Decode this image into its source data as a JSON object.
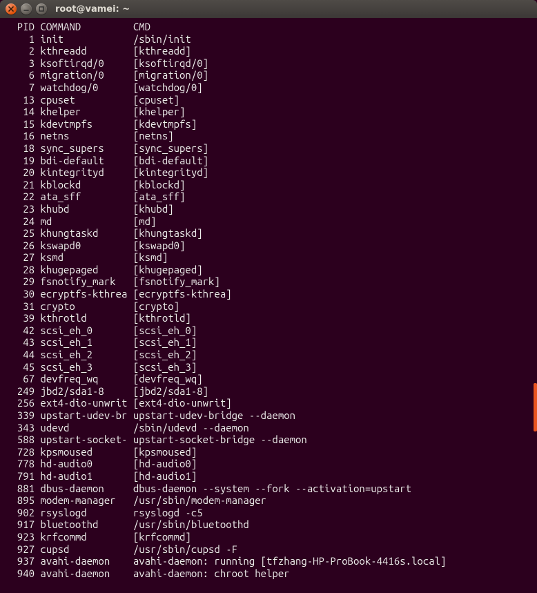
{
  "window": {
    "title": "root@vamei: ~"
  },
  "header": {
    "col_pid": "  PID",
    "col_command": "COMMAND",
    "col_cmd": "CMD"
  },
  "rows": [
    {
      "pid": "1",
      "command": "init",
      "cmd": "/sbin/init"
    },
    {
      "pid": "2",
      "command": "kthreadd",
      "cmd": "[kthreadd]"
    },
    {
      "pid": "3",
      "command": "ksoftirqd/0",
      "cmd": "[ksoftirqd/0]"
    },
    {
      "pid": "6",
      "command": "migration/0",
      "cmd": "[migration/0]"
    },
    {
      "pid": "7",
      "command": "watchdog/0",
      "cmd": "[watchdog/0]"
    },
    {
      "pid": "13",
      "command": "cpuset",
      "cmd": "[cpuset]"
    },
    {
      "pid": "14",
      "command": "khelper",
      "cmd": "[khelper]"
    },
    {
      "pid": "15",
      "command": "kdevtmpfs",
      "cmd": "[kdevtmpfs]"
    },
    {
      "pid": "16",
      "command": "netns",
      "cmd": "[netns]"
    },
    {
      "pid": "18",
      "command": "sync_supers",
      "cmd": "[sync_supers]"
    },
    {
      "pid": "19",
      "command": "bdi-default",
      "cmd": "[bdi-default]"
    },
    {
      "pid": "20",
      "command": "kintegrityd",
      "cmd": "[kintegrityd]"
    },
    {
      "pid": "21",
      "command": "kblockd",
      "cmd": "[kblockd]"
    },
    {
      "pid": "22",
      "command": "ata_sff",
      "cmd": "[ata_sff]"
    },
    {
      "pid": "23",
      "command": "khubd",
      "cmd": "[khubd]"
    },
    {
      "pid": "24",
      "command": "md",
      "cmd": "[md]"
    },
    {
      "pid": "25",
      "command": "khungtaskd",
      "cmd": "[khungtaskd]"
    },
    {
      "pid": "26",
      "command": "kswapd0",
      "cmd": "[kswapd0]"
    },
    {
      "pid": "27",
      "command": "ksmd",
      "cmd": "[ksmd]"
    },
    {
      "pid": "28",
      "command": "khugepaged",
      "cmd": "[khugepaged]"
    },
    {
      "pid": "29",
      "command": "fsnotify_mark",
      "cmd": "[fsnotify_mark]"
    },
    {
      "pid": "30",
      "command": "ecryptfs-kthrea",
      "cmd": "[ecryptfs-kthrea]"
    },
    {
      "pid": "31",
      "command": "crypto",
      "cmd": "[crypto]"
    },
    {
      "pid": "39",
      "command": "kthrotld",
      "cmd": "[kthrotld]"
    },
    {
      "pid": "42",
      "command": "scsi_eh_0",
      "cmd": "[scsi_eh_0]"
    },
    {
      "pid": "43",
      "command": "scsi_eh_1",
      "cmd": "[scsi_eh_1]"
    },
    {
      "pid": "44",
      "command": "scsi_eh_2",
      "cmd": "[scsi_eh_2]"
    },
    {
      "pid": "45",
      "command": "scsi_eh_3",
      "cmd": "[scsi_eh_3]"
    },
    {
      "pid": "67",
      "command": "devfreq_wq",
      "cmd": "[devfreq_wq]"
    },
    {
      "pid": "249",
      "command": "jbd2/sda1-8",
      "cmd": "[jbd2/sda1-8]"
    },
    {
      "pid": "256",
      "command": "ext4-dio-unwrit",
      "cmd": "[ext4-dio-unwrit]"
    },
    {
      "pid": "339",
      "command": "upstart-udev-br",
      "cmd": "upstart-udev-bridge --daemon"
    },
    {
      "pid": "343",
      "command": "udevd",
      "cmd": "/sbin/udevd --daemon"
    },
    {
      "pid": "588",
      "command": "upstart-socket-",
      "cmd": "upstart-socket-bridge --daemon"
    },
    {
      "pid": "728",
      "command": "kpsmoused",
      "cmd": "[kpsmoused]"
    },
    {
      "pid": "778",
      "command": "hd-audio0",
      "cmd": "[hd-audio0]"
    },
    {
      "pid": "791",
      "command": "hd-audio1",
      "cmd": "[hd-audio1]"
    },
    {
      "pid": "881",
      "command": "dbus-daemon",
      "cmd": "dbus-daemon --system --fork --activation=upstart"
    },
    {
      "pid": "895",
      "command": "modem-manager",
      "cmd": "/usr/sbin/modem-manager"
    },
    {
      "pid": "902",
      "command": "rsyslogd",
      "cmd": "rsyslogd -c5"
    },
    {
      "pid": "917",
      "command": "bluetoothd",
      "cmd": "/usr/sbin/bluetoothd"
    },
    {
      "pid": "923",
      "command": "krfcommd",
      "cmd": "[krfcommd]"
    },
    {
      "pid": "927",
      "command": "cupsd",
      "cmd": "/usr/sbin/cupsd -F"
    },
    {
      "pid": "937",
      "command": "avahi-daemon",
      "cmd": "avahi-daemon: running [tfzhang-HP-ProBook-4416s.local]"
    },
    {
      "pid": "940",
      "command": "avahi-daemon",
      "cmd": "avahi-daemon: chroot helper"
    }
  ]
}
